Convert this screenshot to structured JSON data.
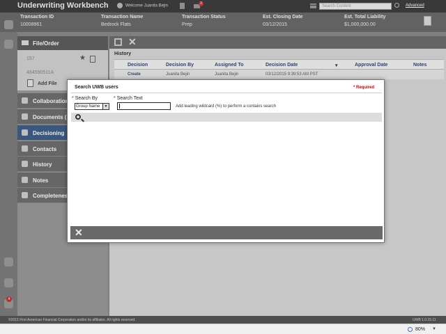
{
  "header": {
    "app_title": "Underwriting Workbench",
    "welcome": "Welcome Juanita Bejin",
    "mail_count": "3",
    "search_placeholder": "Search Content",
    "advanced_link": "Advanced"
  },
  "transaction": {
    "id_label": "Transaction ID",
    "id_value": "10008961",
    "name_label": "Transaction Name",
    "name_value": "Bedrock Flats",
    "status_label": "Transaction Status",
    "status_value": "Prep",
    "closing_label": "Est. Closing Date",
    "closing_value": "03/12/2015",
    "liability_label": "Est. Total Liability",
    "liability_value": "$1,000,000.00"
  },
  "rail": {
    "notification_count": "4"
  },
  "left_panel": {
    "file_order_title": "File/Order",
    "file_number_1": "157",
    "file_number_2": "484590511A",
    "add_file_label": "Add File",
    "nav": [
      {
        "label": "Collaboration",
        "icon": "collaboration-icon"
      },
      {
        "label": "Documents (",
        "icon": "documents-icon"
      },
      {
        "label": "Decisioning",
        "icon": "decisioning-icon"
      },
      {
        "label": "Contacts",
        "icon": "contacts-icon"
      },
      {
        "label": "History",
        "icon": "history-icon"
      },
      {
        "label": "Notes",
        "icon": "notes-icon"
      },
      {
        "label": "Completeness",
        "icon": "completeness-icon"
      }
    ]
  },
  "history": {
    "title": "History",
    "columns": [
      "Decision",
      "Decision By",
      "Assigned To",
      "Decision Date",
      "Approval Date",
      "Notes"
    ],
    "rows": [
      [
        "Create",
        "Juanita Bejin",
        "Juanita Bejin",
        "03/12/2015 9:39:53 AM PST",
        "",
        ""
      ]
    ]
  },
  "modal": {
    "title": "Search UWB users",
    "required_note": "* Required",
    "search_by_label": "Search By",
    "search_by_value": "Group Name",
    "search_text_label": "Search Text",
    "search_text_value": "",
    "wildcard_hint": "Add leading wildcard (%) to perform a contains search"
  },
  "footer": {
    "copyright": "©2015 First American Financial Corporation and/or its affiliates. All rights reserved.",
    "version": "UWB 1.0.15.11"
  },
  "statusbar": {
    "zoom": "80%"
  },
  "colors": {
    "active_nav": "#3f5f88",
    "required": "#cc0000",
    "badge": "#cc3333"
  }
}
